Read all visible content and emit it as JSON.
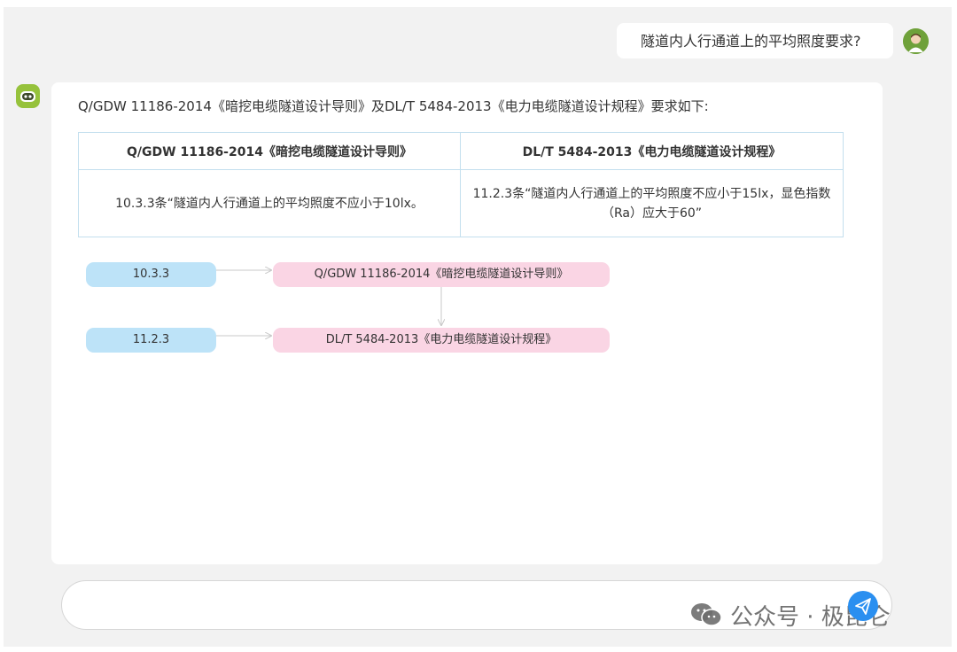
{
  "conversation": {
    "user_message": "隧道内人行通道上的平均照度要求?",
    "bot_intro": "Q/GDW 11186-2014《暗挖电缆隧道设计导则》及DL/T 5484-2013《电力电缆隧道设计规程》要求如下:"
  },
  "table": {
    "headers": [
      "Q/GDW 11186-2014《暗挖电缆隧道设计导则》",
      "DL/T 5484-2013《电力电缆隧道设计规程》"
    ],
    "row": [
      "10.3.3条“隧道内人行通道上的平均照度不应小于10lx。",
      "11.2.3条“隧道内人行通道上的平均照度不应小于15lx，显色指数（Ra）应大于60”"
    ]
  },
  "diagram": {
    "nodes": [
      {
        "clause": "10.3.3",
        "standard": "Q/GDW 11186-2014《暗挖电缆隧道设计导则》"
      },
      {
        "clause": "11.2.3",
        "standard": "DL/T 5484-2013《电力电缆隧道设计规程》"
      }
    ],
    "colors": {
      "clause_fill": "#bde3f8",
      "standard_fill": "#fad5e4",
      "arrow": "#c8c8c8"
    }
  },
  "input": {
    "placeholder": ""
  },
  "watermark": {
    "text": "公众号 · 极昆仑"
  },
  "icons": {
    "user_avatar": "user-avatar-icon",
    "bot_avatar": "robot-icon",
    "send": "paper-plane-icon",
    "watermark": "wechat-icon"
  },
  "theme": {
    "background": "#f2f2f2",
    "panel": "#ffffff",
    "table_border": "#c3dfee",
    "accent": "#2a8ff0",
    "bot_green": "#96c23c"
  }
}
